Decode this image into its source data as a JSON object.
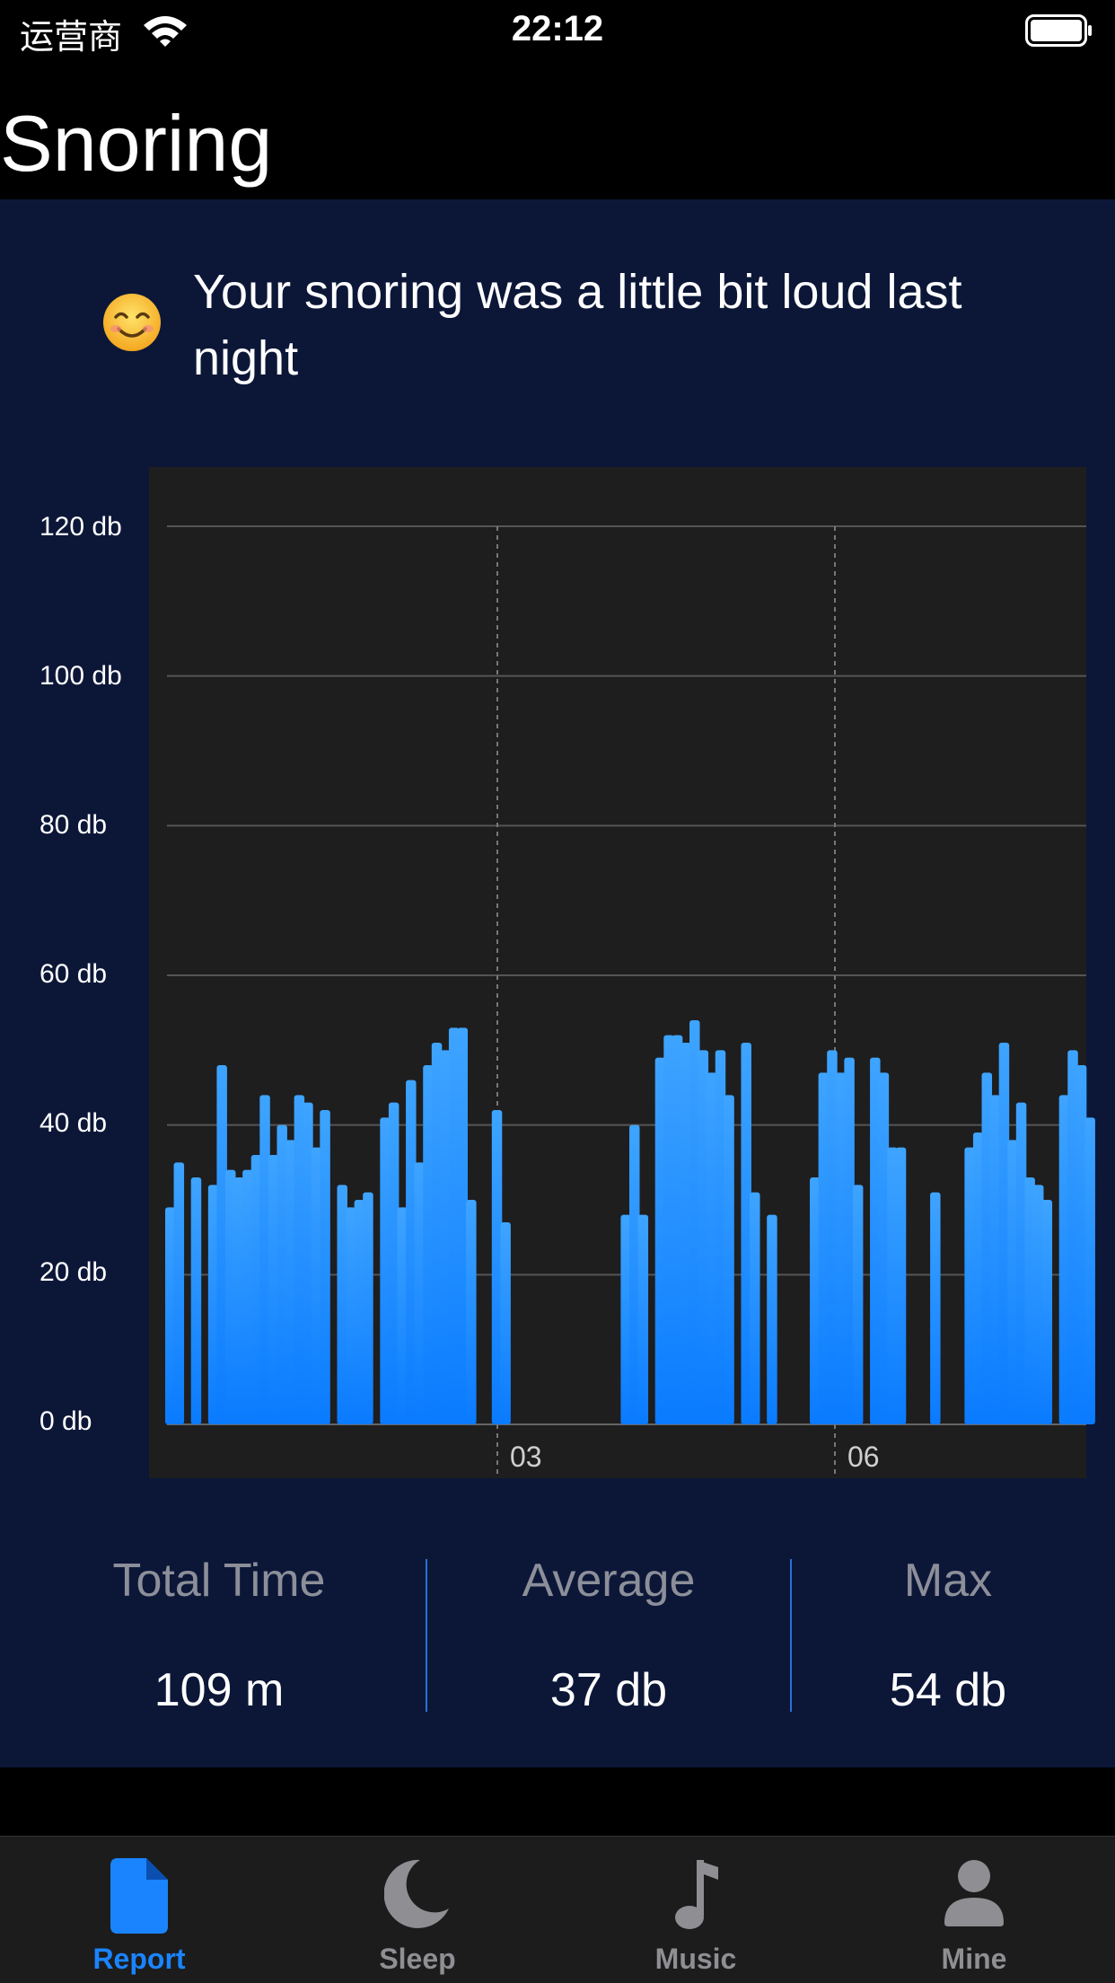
{
  "status_bar": {
    "carrier": "运营商",
    "time": "22:12"
  },
  "header": {
    "title": "Snoring"
  },
  "summary": {
    "emoji": "smiling-face-emoji",
    "message": "Your snoring was a little bit loud last night"
  },
  "chart_data": {
    "type": "bar",
    "y_unit": "db",
    "ylim": [
      0,
      120
    ],
    "y_ticks": [
      "120 db",
      "100 db",
      "80 db",
      "60 db",
      "40 db",
      "20 db",
      "0 db"
    ],
    "x_ticks": [
      "03",
      "06"
    ],
    "grid": true,
    "bar_color": "#1a84ff",
    "values": [
      29,
      35,
      0,
      33,
      0,
      32,
      48,
      34,
      33,
      34,
      36,
      44,
      36,
      40,
      38,
      44,
      43,
      37,
      42,
      0,
      32,
      29,
      30,
      31,
      0,
      41,
      43,
      29,
      46,
      35,
      48,
      51,
      50,
      53,
      53,
      30,
      0,
      0,
      42,
      27,
      0,
      0,
      0,
      0,
      0,
      0,
      0,
      0,
      0,
      0,
      0,
      0,
      0,
      28,
      40,
      28,
      0,
      49,
      52,
      52,
      51,
      54,
      50,
      47,
      50,
      44,
      0,
      51,
      31,
      0,
      28,
      0,
      0,
      0,
      0,
      33,
      47,
      50,
      47,
      49,
      32,
      0,
      49,
      47,
      37,
      37,
      0,
      0,
      0,
      31,
      0,
      0,
      0,
      37,
      39,
      47,
      44,
      51,
      38,
      43,
      33,
      32,
      30,
      0,
      44,
      50,
      48,
      41
    ]
  },
  "stats": [
    {
      "label": "Total Time",
      "value": "109 m"
    },
    {
      "label": "Average",
      "value": "37 db"
    },
    {
      "label": "Max",
      "value": "54 db"
    }
  ],
  "tabs": [
    {
      "label": "Report",
      "icon": "document-icon",
      "active": true
    },
    {
      "label": "Sleep",
      "icon": "moon-icon",
      "active": false
    },
    {
      "label": "Music",
      "icon": "music-note-icon",
      "active": false
    },
    {
      "label": "Mine",
      "icon": "person-icon",
      "active": false
    }
  ],
  "colors": {
    "accent": "#1a84ff",
    "card_background": "#0c1738",
    "chart_background": "#1e1e1f"
  }
}
